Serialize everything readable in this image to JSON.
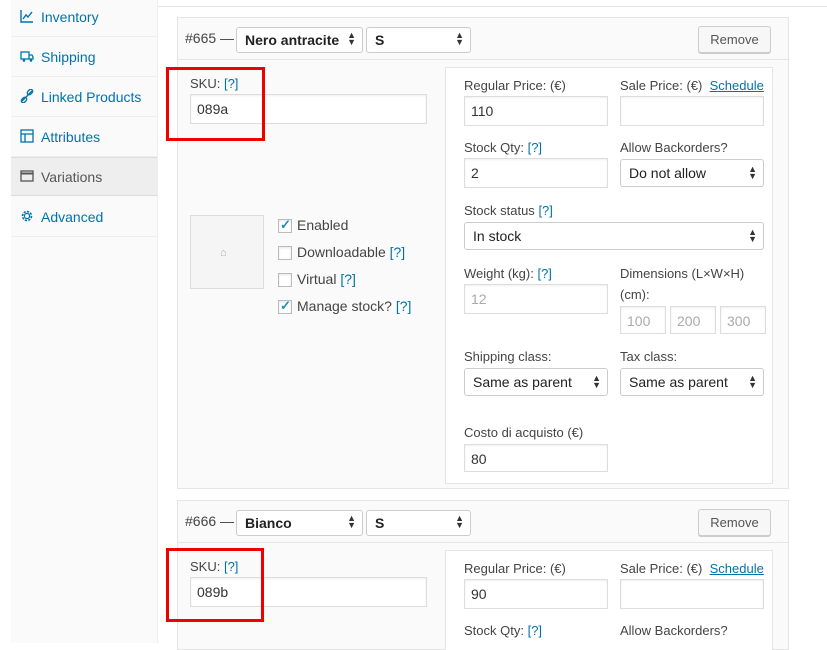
{
  "tabs": [
    {
      "label": "Inventory",
      "icon": "chart-icon"
    },
    {
      "label": "Shipping",
      "icon": "truck-icon"
    },
    {
      "label": "Linked Products",
      "icon": "link-icon"
    },
    {
      "label": "Attributes",
      "icon": "table-icon"
    },
    {
      "label": "Variations",
      "icon": "window-icon",
      "active": true
    },
    {
      "label": "Advanced",
      "icon": "gear-icon"
    }
  ],
  "colors": {
    "link": "#0073aa",
    "highlight": "#e00000"
  },
  "help": "[?]",
  "variations": [
    {
      "id": "#665 —",
      "attr1": "Nero antracite",
      "attr2": "S",
      "remove": "Remove",
      "sku_label": "SKU:",
      "sku": "089a",
      "regular_price_label": "Regular Price: (€)",
      "regular_price": "110",
      "sale_price_label": "Sale Price: (€)",
      "schedule": "Schedule",
      "sale_price": "",
      "stock_qty_label": "Stock Qty:",
      "stock_qty": "2",
      "backorders_label": "Allow Backorders?",
      "backorders": "Do not allow",
      "stock_status_label": "Stock status",
      "stock_status": "In stock",
      "weight_label": "Weight (kg):",
      "weight_placeholder": "12",
      "dimensions_label": "Dimensions (L×W×H)",
      "dimensions_unit": "(cm):",
      "dim_l": "100",
      "dim_w": "200",
      "dim_h": "300",
      "shipping_class_label": "Shipping class:",
      "shipping_class": "Same as parent",
      "tax_class_label": "Tax class:",
      "tax_class": "Same as parent",
      "cost_label": "Costo di acquisto (€)",
      "cost": "80",
      "checkboxes": [
        {
          "label": "Enabled",
          "checked": true,
          "help": false
        },
        {
          "label": "Downloadable",
          "checked": false,
          "help": true
        },
        {
          "label": "Virtual",
          "checked": false,
          "help": true
        },
        {
          "label": "Manage stock?",
          "checked": true,
          "help": true
        }
      ]
    },
    {
      "id": "#666 —",
      "attr1": "Bianco",
      "attr2": "S",
      "remove": "Remove",
      "sku_label": "SKU:",
      "sku": "089b",
      "regular_price_label": "Regular Price: (€)",
      "regular_price": "90",
      "sale_price_label": "Sale Price: (€)",
      "schedule": "Schedule",
      "sale_price": "",
      "stock_qty_label": "Stock Qty:",
      "backorders_label": "Allow Backorders?"
    }
  ]
}
